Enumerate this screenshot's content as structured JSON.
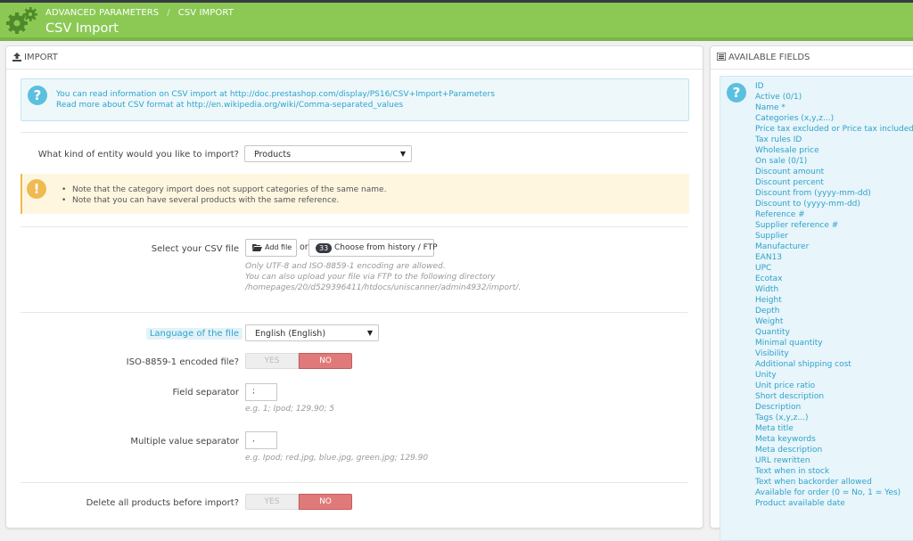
{
  "header": {
    "breadcrumb": [
      "ADVANCED PARAMETERS",
      "CSV IMPORT"
    ],
    "title": "CSV Import",
    "gear_icon": "gears-icon",
    "color": "#8bc954"
  },
  "import_panel": {
    "heading": "IMPORT",
    "heading_icon": "upload-icon",
    "info_icon": "question-circle-icon",
    "info_lines": [
      "You can read information on CSV import at http://doc.prestashop.com/display/PS16/CSV+Import+Parameters",
      "Read more about CSV format at http://en.wikipedia.org/wiki/Comma-separated_values"
    ],
    "entity_label": "What kind of entity would you like to import?",
    "entity_value": "Products",
    "warn_icon": "exclamation-circle-icon",
    "warn_lines": [
      "Note that the category import does not support categories of the same name.",
      "Note that you can have several products with the same reference."
    ],
    "csv_label": "Select your CSV file",
    "add_file_label": "Add file",
    "or_text": "or",
    "history_count": "33",
    "history_label": "Choose from history / FTP",
    "csv_help": [
      "Only UTF-8 and ISO-8859-1 encoding are allowed.",
      "You can also upload your file via FTP to the following directory",
      "/homepages/20/d529396411/htdocs/uniscanner/admin4932/import/."
    ],
    "language_label": "Language of the file",
    "language_value": "English (English)",
    "iso_label": "ISO-8859-1 encoded file?",
    "yes_label": "YES",
    "no_label": "NO",
    "field_sep_label": "Field separator",
    "field_sep_value": ";",
    "field_sep_help": "e.g. 1; Ipod; 129.90; 5",
    "multi_sep_label": "Multiple value separator",
    "multi_sep_value": ",",
    "multi_sep_help": "e.g. Ipod; red.jpg, blue.jpg, green.jpg; 129.90",
    "delete_label": "Delete all products before import?",
    "no_color": "#e07a7a",
    "info_color": "#2ea2cc",
    "warn_color": "#f0b953"
  },
  "fields_panel": {
    "heading": "AVAILABLE FIELDS",
    "heading_icon": "list-icon",
    "info_icon": "question-circle-icon",
    "fields": [
      "ID",
      "Active (0/1)",
      "Name *",
      "Categories (x,y,z...)",
      "Price tax excluded or Price tax included",
      "Tax rules ID",
      "Wholesale price",
      "On sale (0/1)",
      "Discount amount",
      "Discount percent",
      "Discount from (yyyy-mm-dd)",
      "Discount to (yyyy-mm-dd)",
      "Reference #",
      "Supplier reference #",
      "Supplier",
      "Manufacturer",
      "EAN13",
      "UPC",
      "Ecotax",
      "Width",
      "Height",
      "Depth",
      "Weight",
      "Quantity",
      "Minimal quantity",
      "Visibility",
      "Additional shipping cost",
      "Unity",
      "Unit price ratio",
      "Short description",
      "Description",
      "Tags (x,y,z...)",
      "Meta title",
      "Meta keywords",
      "Meta description",
      "URL rewritten",
      "Text when in stock",
      "Text when backorder allowed",
      "Available for order (0 = No, 1 = Yes)",
      "Product available date"
    ]
  }
}
